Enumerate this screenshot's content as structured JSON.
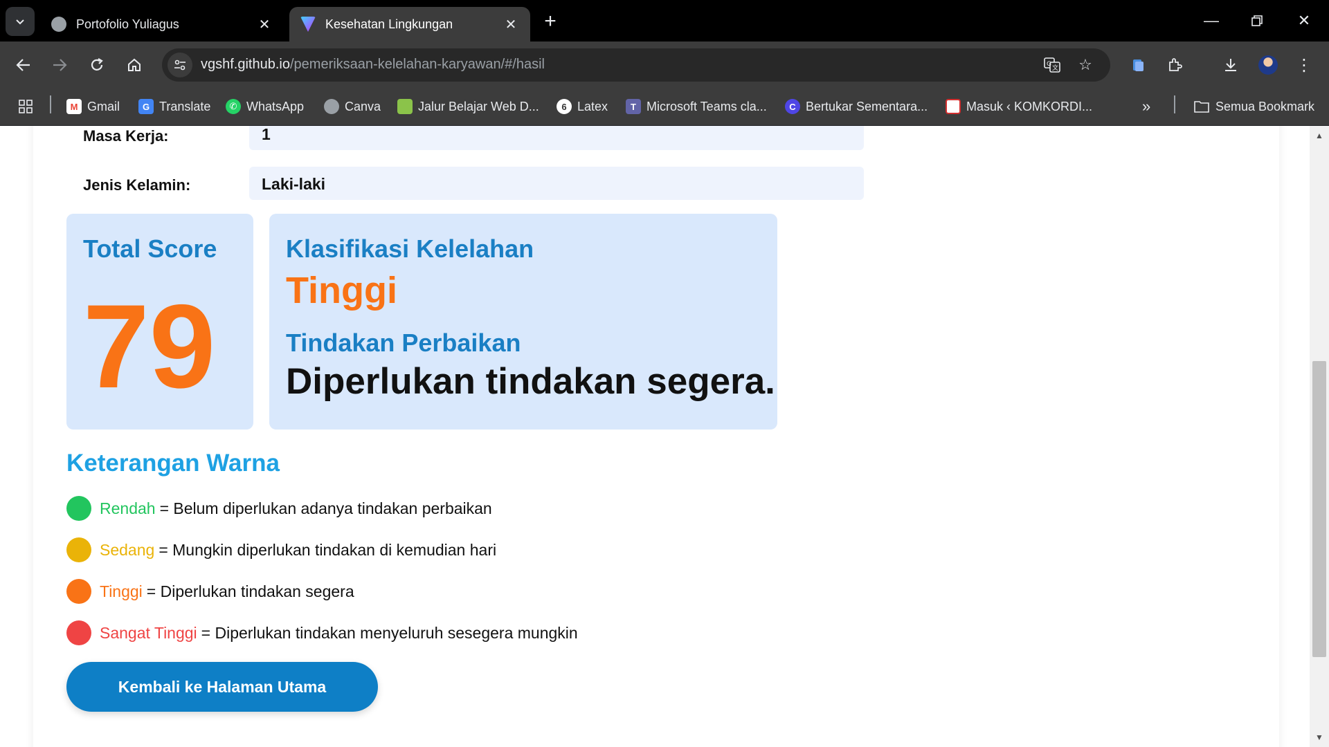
{
  "browser": {
    "tabs": [
      {
        "title": "Portofolio Yuliagus",
        "active": false
      },
      {
        "title": "Kesehatan Lingkungan",
        "active": true
      }
    ],
    "url_domain": "vgshf.github.io",
    "url_path": "/pemeriksaan-kelelahan-karyawan/#/hasil",
    "bookmarks": [
      {
        "label": "Gmail",
        "icon": "gmail-icon",
        "color": "#ea4335"
      },
      {
        "label": "Translate",
        "icon": "translate-icon",
        "color": "#4285f4"
      },
      {
        "label": "WhatsApp",
        "icon": "whatsapp-icon",
        "color": "#25d366"
      },
      {
        "label": "Canva",
        "icon": "globe-icon",
        "color": "#9aa0a6"
      },
      {
        "label": "Jalur Belajar Web D...",
        "icon": "bookmark-site-icon",
        "color": "#8bc34a"
      },
      {
        "label": "Latex",
        "icon": "latex-icon",
        "color": "#ffffff"
      },
      {
        "label": "Microsoft Teams cla...",
        "icon": "teams-icon",
        "color": "#6264a7"
      },
      {
        "label": "Bertukar Sementara...",
        "icon": "c-icon",
        "color": "#4f46e5"
      },
      {
        "label": "Masuk ‹ KOMKORDI...",
        "icon": "site-icon",
        "color": "#d32f2f"
      }
    ],
    "all_bookmarks_label": "Semua Bookmark"
  },
  "form": {
    "masa_kerja_label": "Masa Kerja:",
    "masa_kerja_value": "1",
    "jenis_kelamin_label": "Jenis Kelamin:",
    "jenis_kelamin_value": "Laki-laki"
  },
  "result": {
    "total_score_label": "Total Score",
    "total_score_value": "79",
    "classification_label": "Klasifikasi Kelelahan",
    "classification_value": "Tinggi",
    "action_label": "Tindakan Perbaikan",
    "action_value": "Diperlukan tindakan segera."
  },
  "legend": {
    "title": "Keterangan Warna",
    "items": [
      {
        "name": "Rendah",
        "desc": " = Belum diperlukan adanya tindakan perbaikan",
        "color": "#22c55e"
      },
      {
        "name": "Sedang",
        "desc": " = Mungkin diperlukan tindakan di kemudian hari",
        "color": "#eab308"
      },
      {
        "name": "Tinggi",
        "desc": " = Diperlukan tindakan segera",
        "color": "#f97316"
      },
      {
        "name": "Sangat Tinggi",
        "desc": " = Diperlukan tindakan menyeluruh sesegera mungkin",
        "color": "#ef4444"
      }
    ]
  },
  "home_button_label": "Kembali ke Halaman Utama",
  "colors": {
    "accent_blue": "#1a7fc4",
    "score_orange": "#f97316",
    "button_blue": "#0e7fc6",
    "card_bg": "#d9e8fc"
  }
}
